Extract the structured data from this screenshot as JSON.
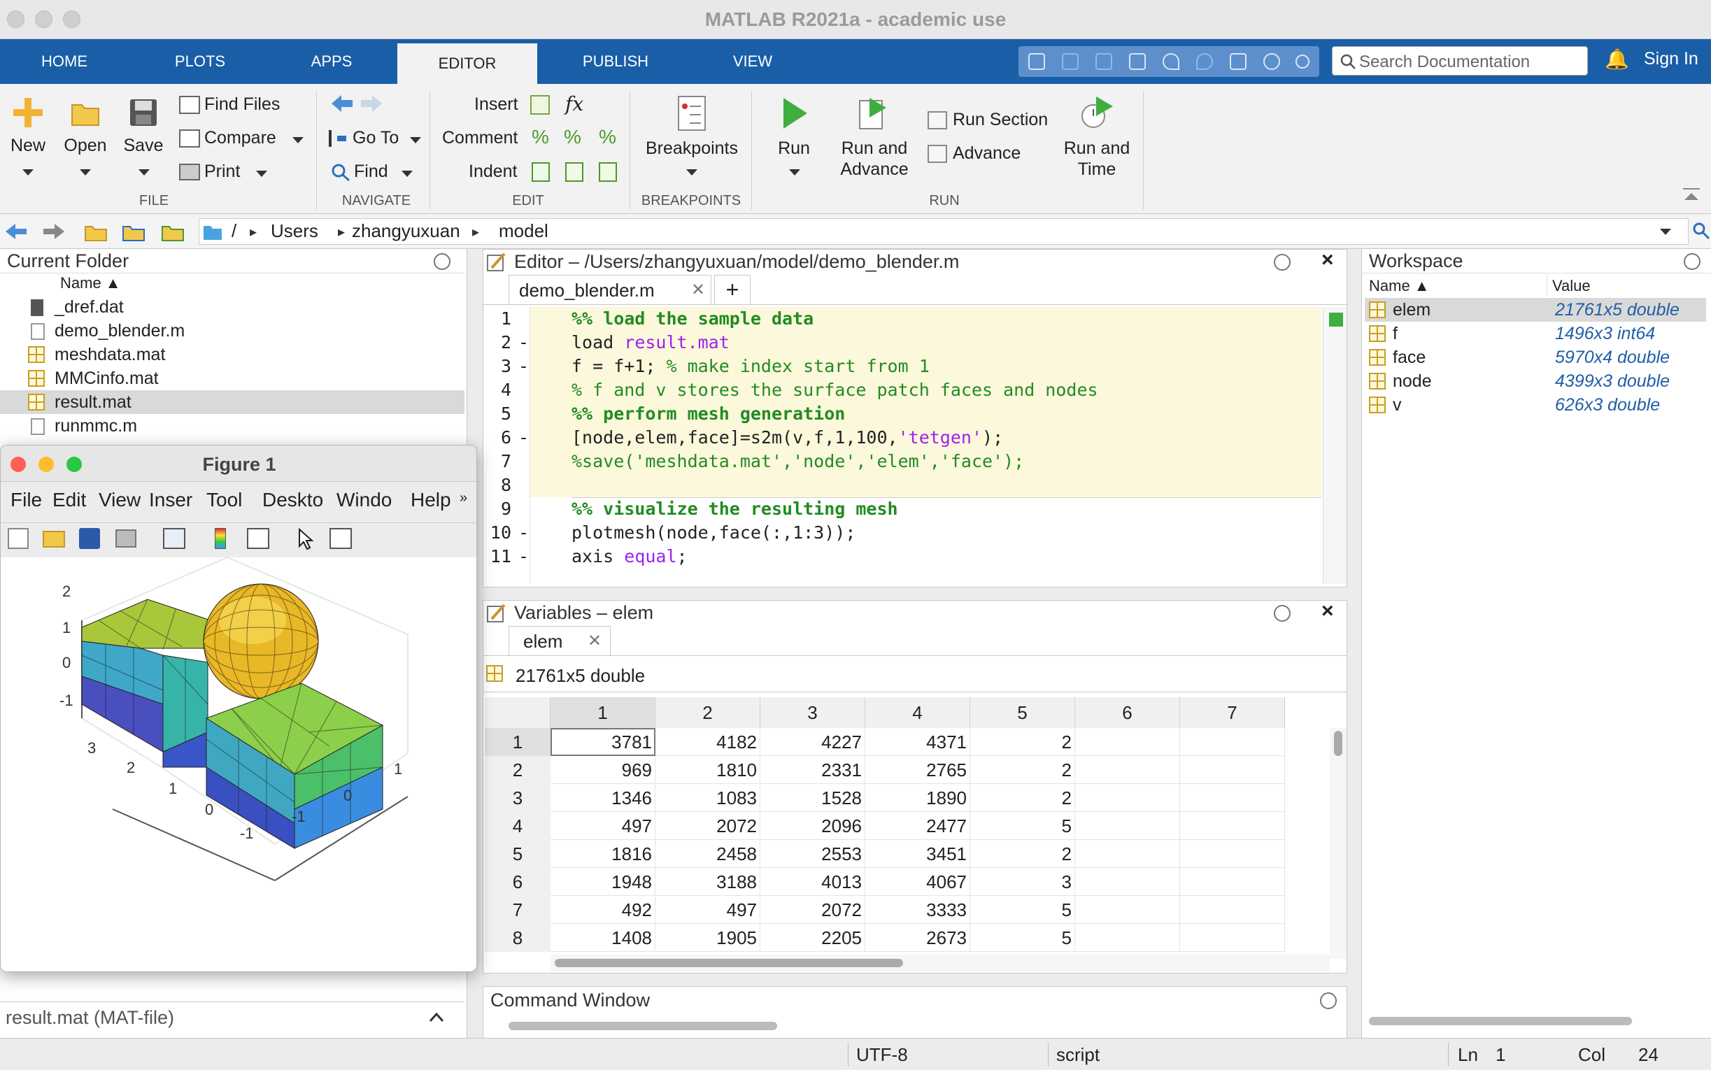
{
  "window": {
    "title": "MATLAB R2021a - academic use"
  },
  "tabs": [
    "HOME",
    "PLOTS",
    "APPS",
    "EDITOR",
    "PUBLISH",
    "VIEW"
  ],
  "search": {
    "placeholder": "Search Documentation"
  },
  "signin": "Sign In",
  "ribbon": {
    "file": {
      "new": "New",
      "open": "Open",
      "save": "Save",
      "find_files": "Find Files",
      "compare": "Compare",
      "print": "Print",
      "section": "FILE"
    },
    "navigate": {
      "goto": "Go To",
      "find": "Find",
      "section": "NAVIGATE"
    },
    "edit": {
      "insert": "Insert",
      "comment": "Comment",
      "indent": "Indent",
      "fx": "fx",
      "section": "EDIT"
    },
    "breakpoints": {
      "label": "Breakpoints",
      "section": "BREAKPOINTS"
    },
    "run": {
      "run": "Run",
      "run_and_advance_1": "Run and",
      "run_and_advance_2": "Advance",
      "run_section": "Run Section",
      "advance": "Advance",
      "run_and_time_1": "Run and",
      "run_and_time_2": "Time",
      "section": "RUN"
    }
  },
  "path": {
    "root": "/",
    "parts": [
      "Users",
      "zhangyuxuan",
      "model"
    ]
  },
  "current_folder": {
    "title": "Current Folder",
    "col_name": "Name ▲",
    "files": [
      "_dref.dat",
      "demo_blender.m",
      "meshdata.mat",
      "MMCinfo.mat",
      "result.mat",
      "runmmc.m"
    ],
    "selected": "result.mat",
    "details": "result.mat  (MAT-file)"
  },
  "editor": {
    "title": "Editor – /Users/zhangyuxuan/model/demo_blender.m",
    "tab": "demo_blender.m",
    "lines": [
      {
        "n": "1",
        "dash": "",
        "text": "%% load the sample data"
      },
      {
        "n": "2",
        "dash": "-",
        "text": "load result.mat"
      },
      {
        "n": "3",
        "dash": "-",
        "text": "f = f+1; % make index start from 1"
      },
      {
        "n": "4",
        "dash": "",
        "text": "% f and v stores the surface patch faces and nodes"
      },
      {
        "n": "5",
        "dash": "",
        "text": "%% perform mesh generation"
      },
      {
        "n": "6",
        "dash": "-",
        "text": "[node,elem,face]=s2m(v,f,1,100,'tetgen');"
      },
      {
        "n": "7",
        "dash": "",
        "text": "%save('meshdata.mat','node','elem','face');"
      },
      {
        "n": "8",
        "dash": "",
        "text": ""
      },
      {
        "n": "9",
        "dash": "",
        "text": "%% visualize the resulting mesh"
      },
      {
        "n": "10",
        "dash": "-",
        "text": "plotmesh(node,face(:,1:3));"
      },
      {
        "n": "11",
        "dash": "-",
        "text": "axis equal;"
      }
    ],
    "seg": {
      "l2a": "load ",
      "l2b": "result.mat",
      "l3a": "f = f+1; ",
      "l3b": "% make index start from 1",
      "l6a": "[node,elem,face]=s2m(v,f,1,100,",
      "l6b": "'tetgen'",
      "l6c": ");",
      "l11a": "axis ",
      "l11b": "equal",
      "l11c": ";"
    }
  },
  "variables": {
    "title": "Variables – elem",
    "tab": "elem",
    "info": "21761x5 double",
    "columns": [
      "1",
      "2",
      "3",
      "4",
      "5",
      "6",
      "7"
    ],
    "rows": [
      {
        "n": "1",
        "v": [
          "3781",
          "4182",
          "4227",
          "4371",
          "2"
        ]
      },
      {
        "n": "2",
        "v": [
          "969",
          "1810",
          "2331",
          "2765",
          "2"
        ]
      },
      {
        "n": "3",
        "v": [
          "1346",
          "1083",
          "1528",
          "1890",
          "2"
        ]
      },
      {
        "n": "4",
        "v": [
          "497",
          "2072",
          "2096",
          "2477",
          "5"
        ]
      },
      {
        "n": "5",
        "v": [
          "1816",
          "2458",
          "2553",
          "3451",
          "2"
        ]
      },
      {
        "n": "6",
        "v": [
          "1948",
          "3188",
          "4013",
          "4067",
          "3"
        ]
      },
      {
        "n": "7",
        "v": [
          "492",
          "497",
          "2072",
          "3333",
          "5"
        ]
      },
      {
        "n": "8",
        "v": [
          "1408",
          "1905",
          "2205",
          "2673",
          "5"
        ]
      }
    ]
  },
  "command_window": {
    "title": "Command Window"
  },
  "workspace": {
    "title": "Workspace",
    "col_name": "Name ▲",
    "col_value": "Value",
    "vars": [
      {
        "name": "elem",
        "value": "21761x5 double"
      },
      {
        "name": "f",
        "value": "1496x3 int64"
      },
      {
        "name": "face",
        "value": "5970x4 double"
      },
      {
        "name": "node",
        "value": "4399x3 double"
      },
      {
        "name": "v",
        "value": "626x3 double"
      }
    ],
    "selected": "elem"
  },
  "figure": {
    "title": "Figure 1",
    "menu": [
      "File",
      "Edit",
      "View",
      "Inser",
      "Tool",
      "Deskto",
      "Windo",
      "Help"
    ],
    "z_ticks": [
      "2",
      "1",
      "0",
      "-1"
    ],
    "y_ticks": [
      "3",
      "2",
      "1",
      "0",
      "-1"
    ],
    "x_ticks": [
      "-1",
      "0",
      "1"
    ]
  },
  "status": {
    "encoding": "UTF-8",
    "type": "script",
    "ln_label": "Ln",
    "ln": "1",
    "col_label": "Col",
    "col": "24"
  },
  "colors": {
    "ribbon_blue": "#1a5ea8",
    "comment_green": "#228b22",
    "string_purple": "#a020f0",
    "value_blue": "#1f5fa8"
  }
}
